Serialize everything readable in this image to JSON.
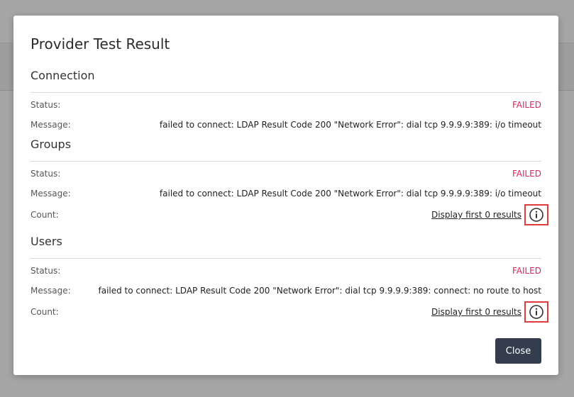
{
  "dialog": {
    "title": "Provider Test Result",
    "close_label": "Close"
  },
  "labels": {
    "status": "Status:",
    "message": "Message:",
    "count": "Count:"
  },
  "sections": [
    {
      "title": "Connection",
      "status": "FAILED",
      "message": "failed to connect: LDAP Result Code 200 \"Network Error\": dial tcp 9.9.9.9:389: i/o timeout"
    },
    {
      "title": "Groups",
      "status": "FAILED",
      "message": "failed to connect: LDAP Result Code 200 \"Network Error\": dial tcp 9.9.9.9:389: i/o timeout",
      "count_link": "Display first 0 results"
    },
    {
      "title": "Users",
      "status": "FAILED",
      "message": "failed to connect: LDAP Result Code 200 \"Network Error\": dial tcp 9.9.9.9:389: connect: no route to host",
      "count_link": "Display first 0 results"
    }
  ],
  "colors": {
    "failed": "#e0235b",
    "close_button": "#333d4d",
    "highlight_box": "#e03c3c"
  },
  "icons": {
    "info": "info-circle-icon"
  }
}
